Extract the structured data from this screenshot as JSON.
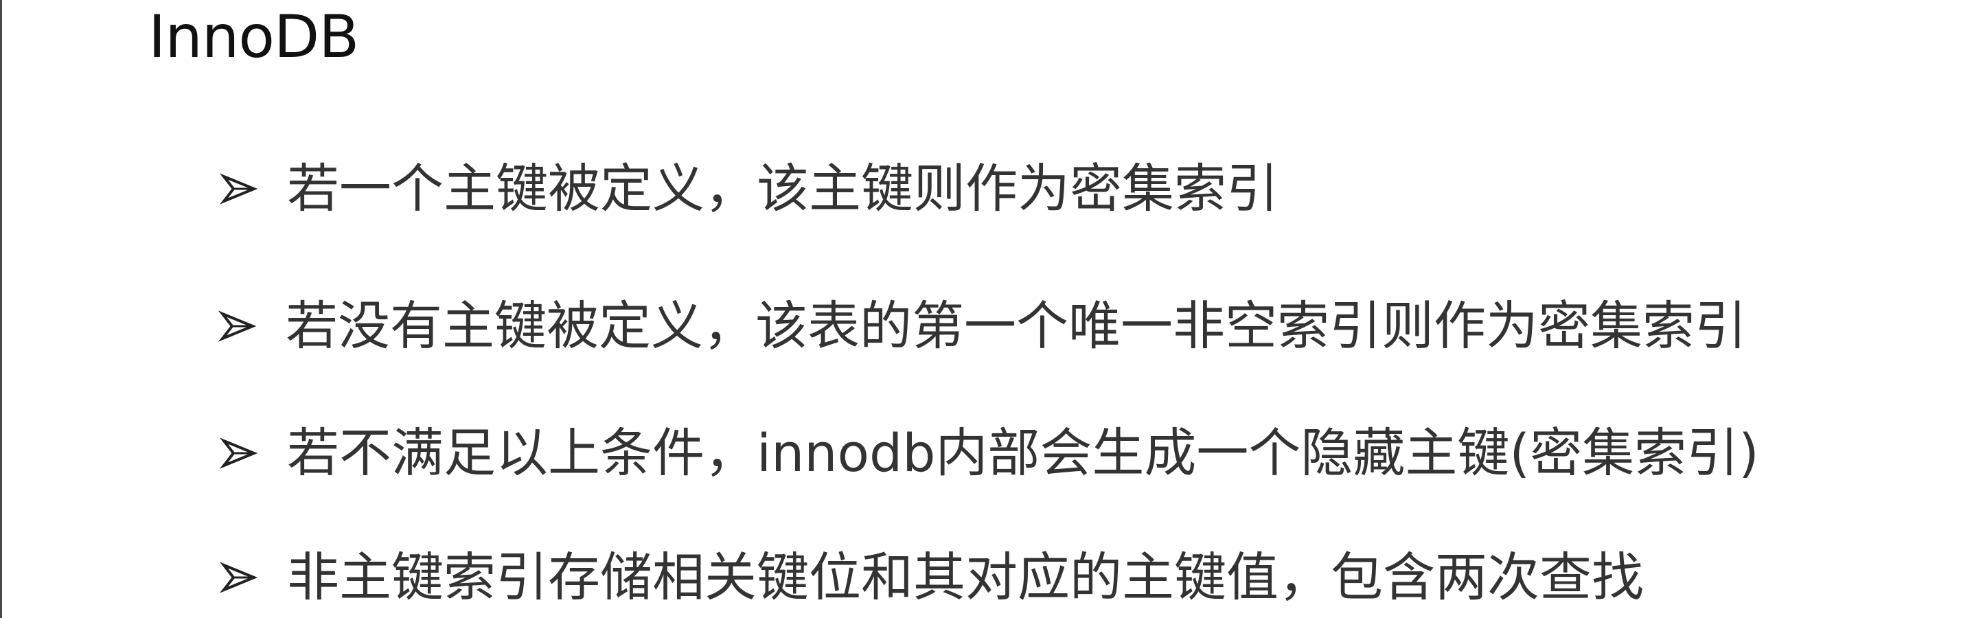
{
  "slide": {
    "title": "InnoDB",
    "bullets": [
      {
        "text": "若一个主键被定义，该主键则作为密集索引",
        "marker_icon": "arrowhead-bullet-icon"
      },
      {
        "text": "若没有主键被定义，该表的第一个唯一非空索引则作为密集索引",
        "marker_icon": "arrowhead-bullet-icon"
      },
      {
        "text": "若不满足以上条件，innodb内部会生成一个隐藏主键(密集索引)",
        "marker_icon": "arrowhead-bullet-icon"
      },
      {
        "text": "非主键索引存储相关键位和其对应的主键值，包含两次查找",
        "marker_icon": "arrowhead-bullet-icon"
      }
    ]
  },
  "colors": {
    "background": "#ffffff",
    "text": "#333333",
    "title": "#111111"
  }
}
